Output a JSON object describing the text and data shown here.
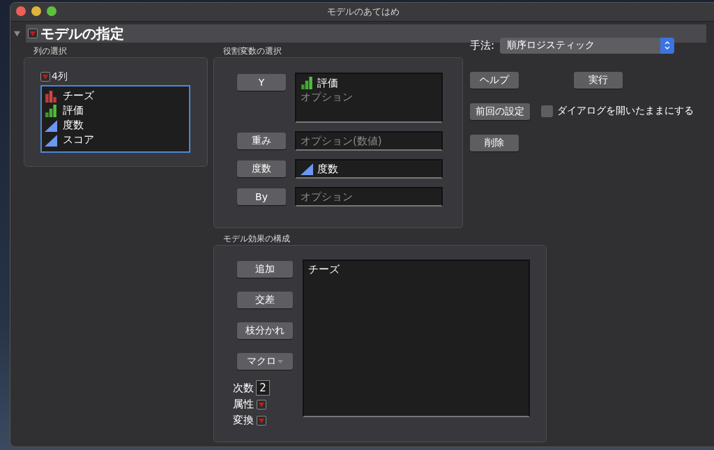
{
  "window": {
    "title": "モデルのあてはめ"
  },
  "outline": {
    "title": "モデルの指定",
    "expanded": true
  },
  "columns_panel": {
    "heading": "列の選択",
    "count": "4列",
    "columns": [
      {
        "name": "チーズ",
        "kind": "nominal"
      },
      {
        "name": "評価",
        "kind": "ordinal"
      },
      {
        "name": "度数",
        "kind": "continuous"
      },
      {
        "name": "スコア",
        "kind": "continuous"
      }
    ]
  },
  "roles_panel": {
    "heading": "役割変数の選択",
    "roles": [
      {
        "button": "Y",
        "items": [
          {
            "name": "評価",
            "kind": "ordinal"
          }
        ],
        "placeholder": "オプション"
      },
      {
        "button": "重み",
        "placeholder": "オプション(数値)"
      },
      {
        "button": "度数",
        "items": [
          {
            "name": "度数",
            "kind": "continuous"
          }
        ]
      },
      {
        "button": "By",
        "placeholder": "オプション"
      }
    ]
  },
  "method": {
    "label": "手法:",
    "value": "順序ロジスティック"
  },
  "actions": {
    "help": "ヘルプ",
    "run": "実行",
    "recall": "前回の設定",
    "remove": "削除",
    "keep_open": {
      "label": "ダイアログを開いたままにする",
      "checked": false
    }
  },
  "effects_panel": {
    "heading": "モデル効果の構成",
    "buttons": [
      {
        "label": "追加",
        "kind": "plain"
      },
      {
        "label": "交差",
        "kind": "plain"
      },
      {
        "label": "枝分かれ",
        "kind": "plain"
      },
      {
        "label": "マクロ",
        "kind": "menu"
      }
    ],
    "degree": {
      "label": "次数",
      "value": "2"
    },
    "menus": [
      {
        "label": "属性"
      },
      {
        "label": "変換"
      }
    ],
    "effects": [
      "チーズ"
    ]
  }
}
